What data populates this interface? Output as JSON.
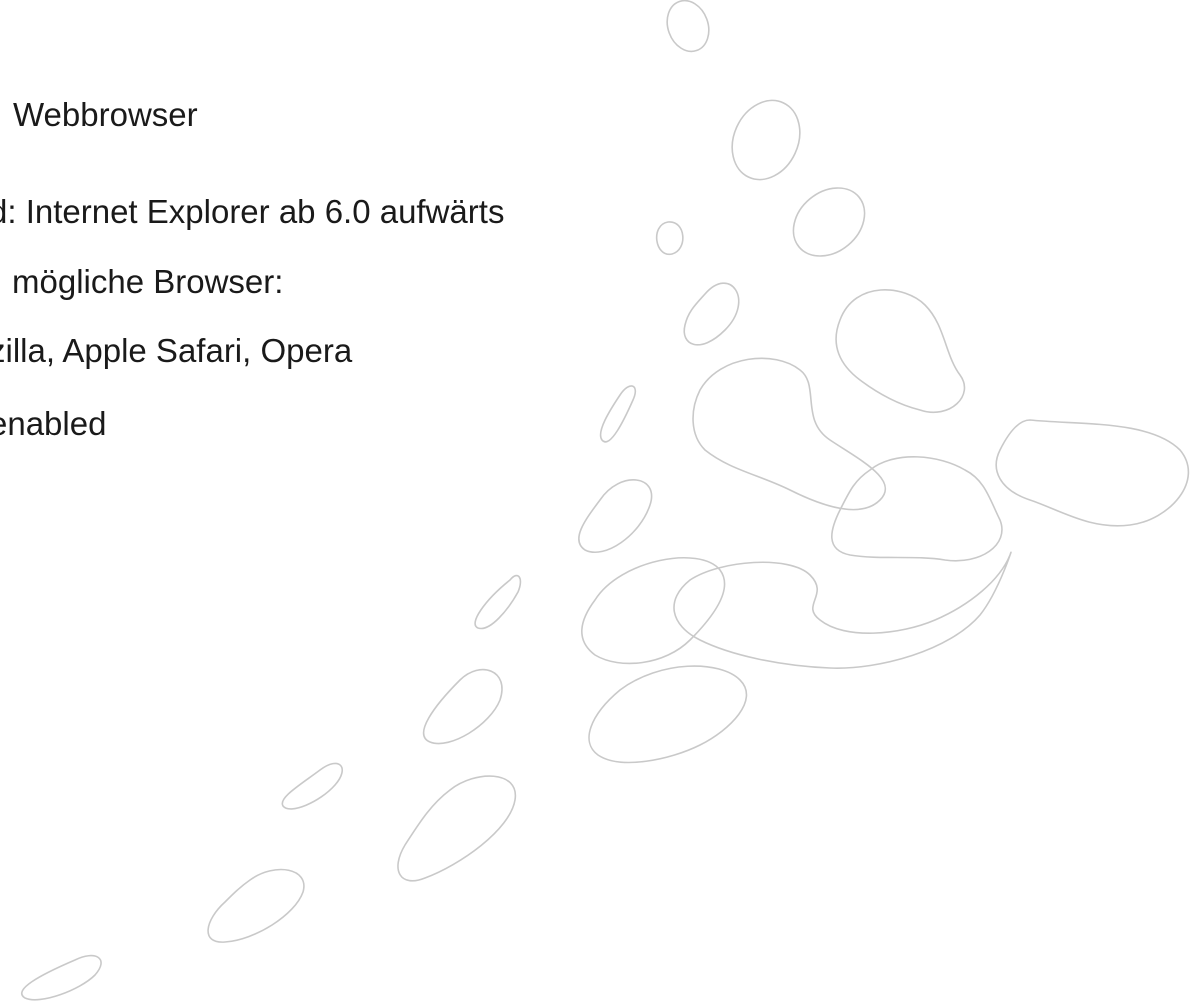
{
  "slide": {
    "heading": "Webbrowser",
    "lines": [
      "d: Internet Explorer ab 6.0 aufwärts",
      "mögliche Browser:",
      "zilla, Apple Safari, Opera",
      "enabled"
    ]
  },
  "colors": {
    "text": "#1a1a1a",
    "decoration_stroke": "#c9c9c9",
    "background": "#ffffff"
  }
}
